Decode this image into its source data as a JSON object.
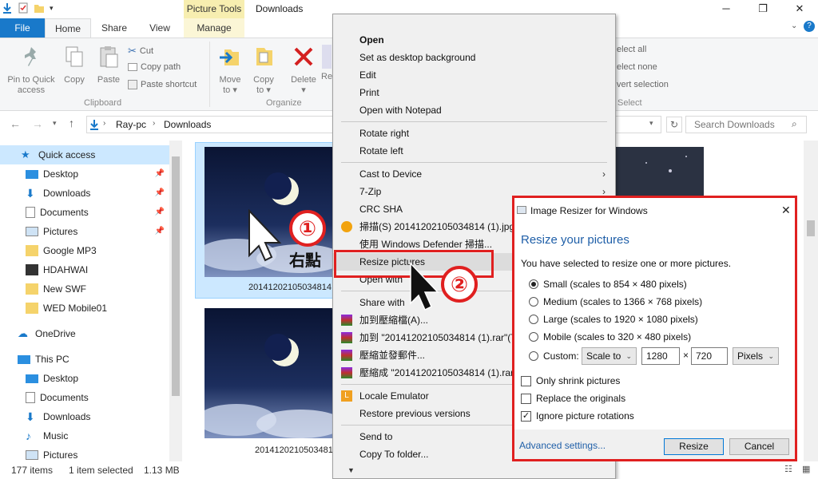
{
  "titlebar": {
    "context_tab": "Picture Tools",
    "title": "Downloads",
    "minimize": "─",
    "maximize": "❐",
    "close": "✕"
  },
  "tabs": {
    "file": "File",
    "home": "Home",
    "share": "Share",
    "view": "View",
    "manage": "Manage"
  },
  "ribbon": {
    "pin_label_1": "Pin to Quick",
    "pin_label_2": "access",
    "copy": "Copy",
    "paste": "Paste",
    "cut": "Cut",
    "copy_path": "Copy path",
    "paste_shortcut": "Paste shortcut",
    "clipboard_group": "Clipboard",
    "move_to_1": "Move",
    "move_to_2": "to ▾",
    "copy_to_1": "Copy",
    "copy_to_2": "to ▾",
    "delete_1": "Delete",
    "delete_2": "▾",
    "rename_partial": "Re",
    "organize_group": "Organize",
    "select_all": "elect all",
    "select_none": "elect none",
    "invert_selection": "vert selection",
    "select_group": "Select"
  },
  "address": {
    "path_1": "Ray-pc",
    "path_2": "Downloads",
    "search_placeholder": "Search Downloads"
  },
  "nav": {
    "quick_access": "Quick access",
    "desktop": "Desktop",
    "downloads": "Downloads",
    "documents": "Documents",
    "pictures": "Pictures",
    "google_mp3": "Google MP3",
    "hdahwai": "HDAHWAI",
    "new_swf": "New SWF",
    "wed_mobile": "WED Mobile01",
    "onedrive": "OneDrive",
    "this_pc": "This PC",
    "pc_desktop": "Desktop",
    "pc_documents": "Documents",
    "pc_downloads": "Downloads",
    "pc_music": "Music",
    "pc_pictures": "Pictures"
  },
  "files": {
    "file1": "20141202105034814",
    "file2": "20141202105034814",
    "overlay_text": "右點"
  },
  "status": {
    "items": "177 items",
    "selected": "1 item selected",
    "size": "1.13 MB"
  },
  "context_menu": {
    "open": "Open",
    "set_desktop_bg": "Set as desktop background",
    "edit": "Edit",
    "print": "Print",
    "open_notepad": "Open with Notepad",
    "rotate_right": "Rotate right",
    "rotate_left": "Rotate left",
    "cast_to_device": "Cast to Device",
    "seven_zip": "7-Zip",
    "crc_sha": "CRC SHA",
    "scan": "掃描(S) 20141202105034814 (1).jpg",
    "defender": "使用 Windows Defender 掃描...",
    "resize_pictures": "Resize pictures",
    "open_with": "Open with",
    "share_with": "Share with",
    "add_archive": "加到壓縮檔(A)...",
    "add_rar": "加到 \"20141202105034814 (1).rar\"(T)",
    "compress_email": "壓縮並發郵件...",
    "compress_rar_email": "壓縮成 \"20141202105034814 (1).rar\"",
    "locale_emulator": "Locale Emulator",
    "restore_versions": "Restore previous versions",
    "send_to": "Send to",
    "copy_to_folder": "Copy To folder..."
  },
  "dialog": {
    "title": "Image Resizer for Windows",
    "heading": "Resize your pictures",
    "description": "You have selected to resize one or more pictures.",
    "small": "Small (scales to 854 × 480 pixels)",
    "medium": "Medium (scales to 1366 × 768 pixels)",
    "large": "Large (scales to 1920 × 1080 pixels)",
    "mobile": "Mobile (scales to 320 × 480 pixels)",
    "custom": "Custom:",
    "scale_mode": "Scale to",
    "width": "1280",
    "times": "×",
    "height": "720",
    "unit": "Pixels",
    "only_shrink": "Only shrink pictures",
    "replace_originals": "Replace the originals",
    "ignore_rotations": "Ignore picture rotations",
    "advanced": "Advanced settings...",
    "resize_btn": "Resize",
    "cancel_btn": "Cancel",
    "close": "✕"
  },
  "annotations": {
    "step1": "①",
    "step2": "②"
  },
  "colors": {
    "accent": "#1979ca",
    "annotation_red": "#e02020",
    "dialog_heading": "#1f5fa8"
  }
}
